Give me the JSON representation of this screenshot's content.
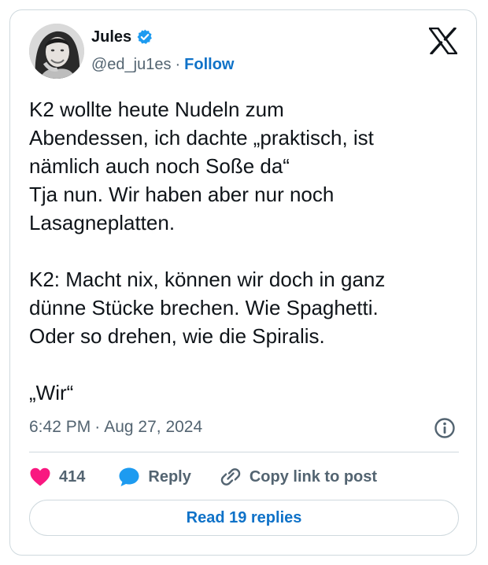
{
  "author": {
    "name": "Jules",
    "handle": "@ed_ju1es",
    "separator": "·",
    "follow_label": "Follow",
    "verified_icon": "verified-badge-icon",
    "avatar_icon": "avatar"
  },
  "brand": {
    "logo": "x-logo-icon"
  },
  "tweet": {
    "text": "K2 wollte heute Nudeln zum\nAbendessen, ich dachte „praktisch, ist\nnämlich auch noch Soße da“\nTja nun. Wir haben aber nur noch\nLasagneplatten.\n\nK2: Macht nix, können wir doch in ganz\ndünne Stücke brechen. Wie Spaghetti.\nOder so drehen, wie die Spiralis.\n\n„Wir“",
    "time": "6:42 PM",
    "separator": "·",
    "date": "Aug 27, 2024",
    "info_icon": "info-icon"
  },
  "actions": {
    "like_count": "414",
    "like_icon": "heart-icon",
    "reply_label": "Reply",
    "reply_icon": "reply-bubble-icon",
    "copy_link_label": "Copy link to post",
    "copy_link_icon": "link-icon"
  },
  "footer": {
    "read_replies_label": "Read 19 replies"
  },
  "colors": {
    "link_blue": "#0f72c8",
    "verified_blue": "#1d9bf0",
    "heart_pink": "#f91880",
    "text_primary": "#0f1419",
    "text_secondary": "#536471",
    "border": "#cfd9de"
  }
}
